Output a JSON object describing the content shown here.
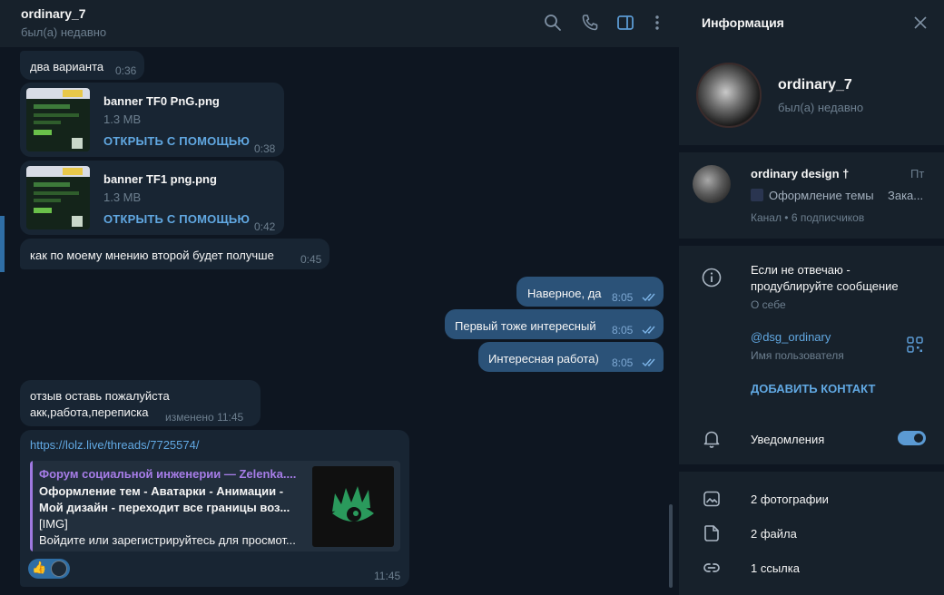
{
  "chat": {
    "title": "ordinary_7",
    "status": "был(а) недавно",
    "header_icons": [
      "search-icon",
      "phone-icon",
      "sidebar-toggle-icon",
      "more-vertical-icon"
    ]
  },
  "messages": {
    "m1": {
      "text": "два варианта",
      "time": "0:36"
    },
    "f1": {
      "name": "banner TF0  PnG.png",
      "size": "1.3 MB",
      "open": "ОТКРЫТЬ С ПОМОЩЬЮ",
      "time": "0:38"
    },
    "f2": {
      "name": "banner TF1 png.png",
      "size": "1.3 MB",
      "open": "ОТКРЫТЬ С ПОМОЩЬЮ",
      "time": "0:42"
    },
    "m2": {
      "text": "как по моему мнению второй будет получше",
      "time": "0:45"
    },
    "o1": {
      "text": "Наверное, да",
      "time": "8:05"
    },
    "o2": {
      "text": "Первый тоже интересный",
      "time": "8:05"
    },
    "o3": {
      "text": "Интересная работа)",
      "time": "8:05"
    },
    "m3": {
      "line1": "отзыв оставь пожалуйста",
      "line2": "акк,работа,переписка",
      "time": "изменено 11:45"
    },
    "m4": {
      "link": "https://lolz.live/threads/7725574/",
      "preview_site": "Форум социальной инженерии — Zelenka....",
      "preview_l1": "Оформление тем - Аватарки - Анимации -",
      "preview_l2": "Мой дизайн - переходит все границы воз...",
      "preview_l3": "[IMG]",
      "preview_l4": "Войдите или зарегистрируйтесь для просмот...",
      "reaction": "👍",
      "time": "11:45"
    }
  },
  "info": {
    "title": "Информация",
    "name": "ordinary_7",
    "status": "был(а) недавно",
    "channel": {
      "name": "ordinary design †",
      "day": "Пт",
      "message": "Оформление темы",
      "message2": "Зака...",
      "subtitle": "Канал • 6 подписчиков"
    },
    "bio_line1": "Если не отвечаю -",
    "bio_line2": "продублируйте сообщение",
    "bio_label": "О себе",
    "username": "@dsg_ordinary",
    "username_label": "Имя пользователя",
    "add_contact": "ДОБАВИТЬ КОНТАКТ",
    "notifications": "Уведомления",
    "notifications_on": true,
    "photos": "2 фотографии",
    "files": "2 файла",
    "links": "1 ссылка"
  },
  "colors": {
    "accent": "#61a8e2",
    "out_bubble": "#2b5278",
    "in_bubble": "#182533",
    "background": "#0e1621",
    "panel": "#17212b"
  }
}
